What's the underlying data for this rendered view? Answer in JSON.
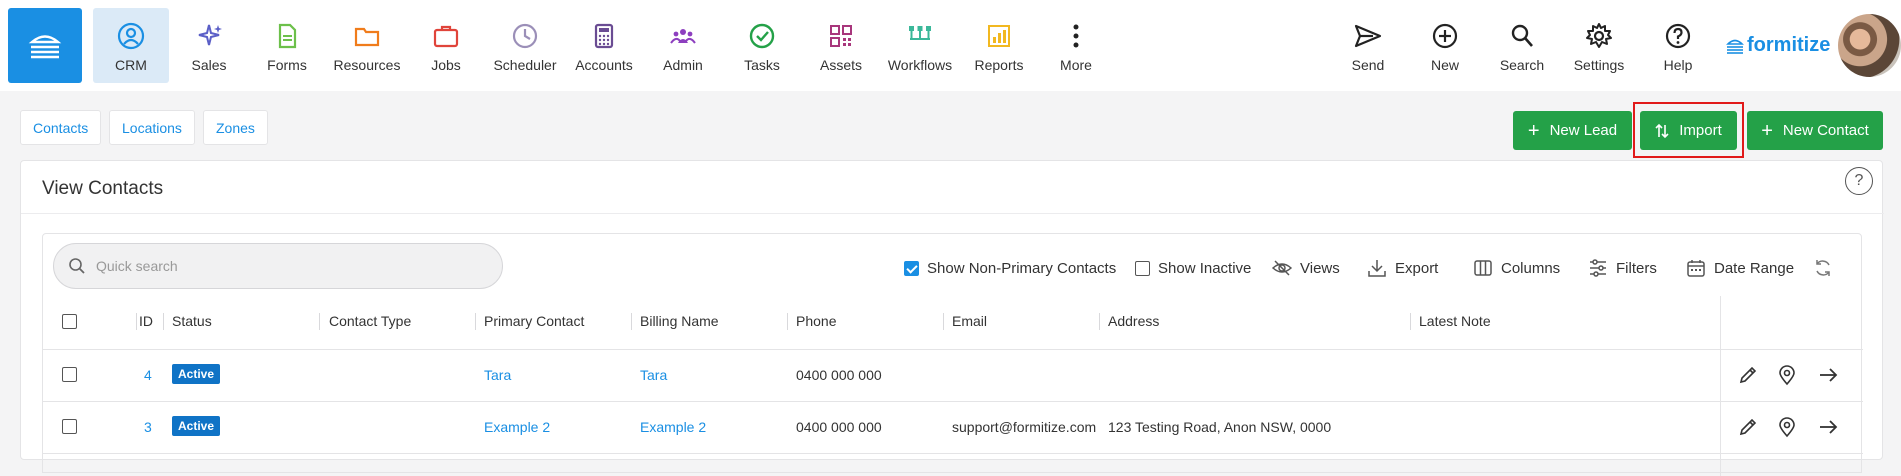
{
  "nav": {
    "items": [
      {
        "id": "crm",
        "label": "CRM",
        "icon": "user-circle-icon",
        "color": "#1a8fe3",
        "active": true
      },
      {
        "id": "sales",
        "label": "Sales",
        "icon": "sparkle-icon",
        "color": "#5b5fc7"
      },
      {
        "id": "forms",
        "label": "Forms",
        "icon": "document-icon",
        "color": "#6cc04a"
      },
      {
        "id": "resources",
        "label": "Resources",
        "icon": "folder-icon",
        "color": "#f07c1b"
      },
      {
        "id": "jobs",
        "label": "Jobs",
        "icon": "briefcase-icon",
        "color": "#e0443a"
      },
      {
        "id": "scheduler",
        "label": "Scheduler",
        "icon": "clock-icon",
        "color": "#9b8fb8"
      },
      {
        "id": "accounts",
        "label": "Accounts",
        "icon": "calculator-icon",
        "color": "#6a4c93"
      },
      {
        "id": "admin",
        "label": "Admin",
        "icon": "group-icon",
        "color": "#8d3fbf"
      },
      {
        "id": "tasks",
        "label": "Tasks",
        "icon": "check-circle-icon",
        "color": "#24a148"
      },
      {
        "id": "assets",
        "label": "Assets",
        "icon": "qr-code-icon",
        "color": "#a8367c"
      },
      {
        "id": "workflows",
        "label": "Workflows",
        "icon": "workflow-icon",
        "color": "#3bb89a"
      },
      {
        "id": "reports",
        "label": "Reports",
        "icon": "chart-icon",
        "color": "#f2b820"
      },
      {
        "id": "more",
        "label": "More",
        "icon": "more-vertical-icon",
        "color": "#222222"
      }
    ],
    "right_items": [
      {
        "id": "send",
        "label": "Send",
        "icon": "send-icon"
      },
      {
        "id": "new",
        "label": "New",
        "icon": "plus-circle-icon"
      },
      {
        "id": "search",
        "label": "Search",
        "icon": "search-icon"
      },
      {
        "id": "settings",
        "label": "Settings",
        "icon": "gear-icon"
      },
      {
        "id": "help",
        "label": "Help",
        "icon": "help-icon"
      }
    ],
    "brand": "formitize",
    "accent": "#1a8fe3"
  },
  "subtabs": [
    "Contacts",
    "Locations",
    "Zones"
  ],
  "actions": {
    "new_lead": "New Lead",
    "import": "Import",
    "new_contact": "New Contact",
    "button_color": "#24a148",
    "highlight_color": "#e11a1a"
  },
  "card": {
    "title": "View Contacts",
    "help": "?"
  },
  "toolbar": {
    "search_placeholder": "Quick search",
    "show_non_primary": "Show Non-Primary Contacts",
    "show_non_primary_checked": true,
    "show_inactive": "Show Inactive",
    "show_inactive_checked": false,
    "views": "Views",
    "export": "Export",
    "columns": "Columns",
    "filters": "Filters",
    "date_range": "Date Range"
  },
  "table": {
    "columns": [
      "ID",
      "Status",
      "Contact Type",
      "Primary Contact",
      "Billing Name",
      "Phone",
      "Email",
      "Address",
      "Latest Note"
    ],
    "rows": [
      {
        "id": "4",
        "status": "Active",
        "contact_type": "",
        "primary_contact": "Tara",
        "billing_name": "Tara",
        "phone": "0400 000 000",
        "email": "",
        "address": "",
        "latest_note": ""
      },
      {
        "id": "3",
        "status": "Active",
        "contact_type": "",
        "primary_contact": "Example 2",
        "billing_name": "Example 2",
        "phone": "0400 000 000",
        "email": "support@formitize.com",
        "address": "123 Testing Road, Anon NSW, 0000",
        "latest_note": ""
      }
    ]
  }
}
